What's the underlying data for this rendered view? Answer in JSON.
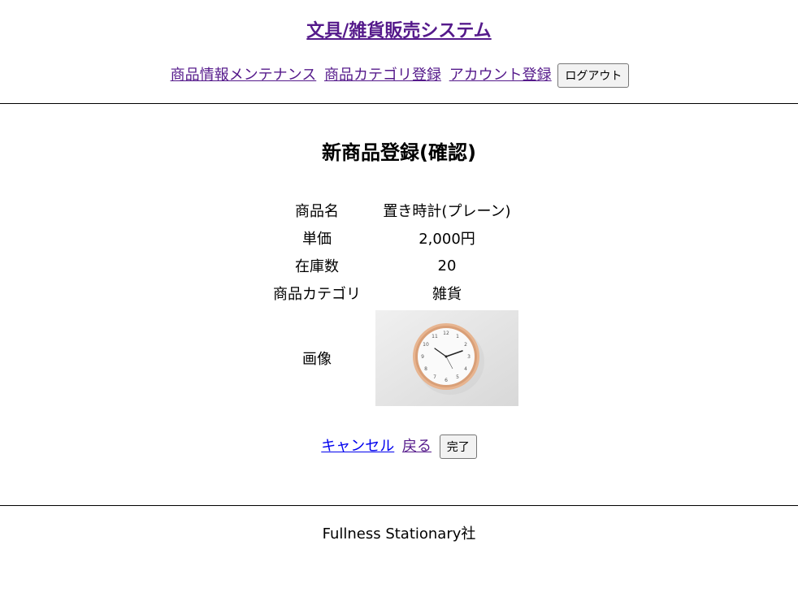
{
  "header": {
    "site_title": "文具/雑貨販売システム",
    "nav": {
      "product_maintenance": "商品情報メンテナンス",
      "category_register": "商品カテゴリ登録",
      "account_register": "アカウント登録",
      "logout_button": "ログアウト"
    }
  },
  "main": {
    "page_title": "新商品登録(確認)",
    "fields": {
      "name_label": "商品名",
      "name_value": "置き時計(プレーン)",
      "price_label": "単価",
      "price_value": "2,000円",
      "stock_label": "在庫数",
      "stock_value": "20",
      "category_label": "商品カテゴリ",
      "category_value": "雑貨",
      "image_label": "画像"
    },
    "actions": {
      "cancel_link": "キャンセル",
      "back_link": "戻る",
      "complete_button": "完了"
    }
  },
  "footer": {
    "company": "Fullness Stationary社"
  }
}
